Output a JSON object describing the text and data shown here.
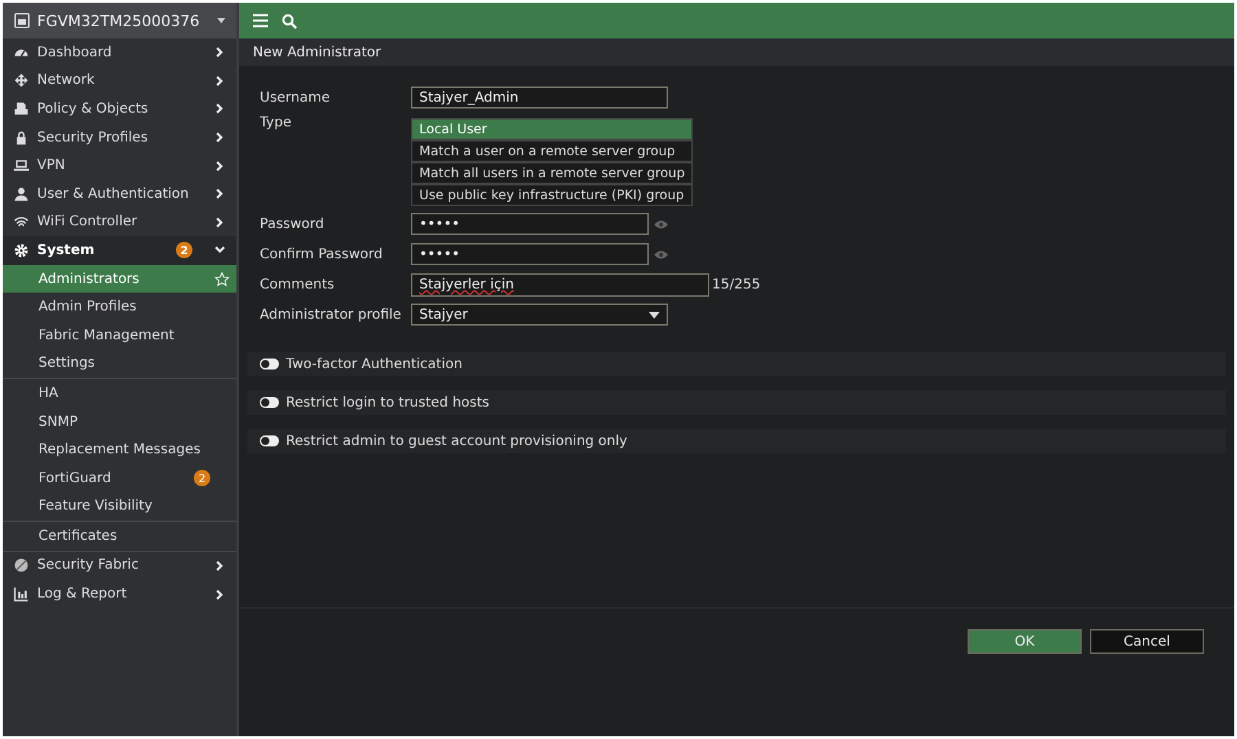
{
  "device": {
    "name": "FGVM32TM25000376"
  },
  "sidebar": {
    "items": [
      {
        "label": "Dashboard",
        "expanded": false
      },
      {
        "label": "Network",
        "expanded": false
      },
      {
        "label": "Policy & Objects",
        "expanded": false
      },
      {
        "label": "Security Profiles",
        "expanded": false
      },
      {
        "label": "VPN",
        "expanded": false
      },
      {
        "label": "User & Authentication",
        "expanded": false
      },
      {
        "label": "WiFi Controller",
        "expanded": false
      },
      {
        "label": "System",
        "expanded": true,
        "badge": "2",
        "groups": [
          [
            {
              "label": "Administrators",
              "selected": true
            },
            {
              "label": "Admin Profiles",
              "selected": false
            },
            {
              "label": "Fabric Management",
              "selected": false
            },
            {
              "label": "Settings",
              "selected": false
            }
          ],
          [
            {
              "label": "HA",
              "selected": false
            },
            {
              "label": "SNMP",
              "selected": false
            },
            {
              "label": "Replacement Messages",
              "selected": false
            },
            {
              "label": "FortiGuard",
              "selected": false,
              "badge": "2"
            },
            {
              "label": "Feature Visibility",
              "selected": false
            }
          ],
          [
            {
              "label": "Certificates",
              "selected": false
            }
          ]
        ]
      },
      {
        "label": "Security Fabric",
        "expanded": false
      },
      {
        "label": "Log & Report",
        "expanded": false
      }
    ]
  },
  "page": {
    "title": "New Administrator"
  },
  "form": {
    "username": {
      "label": "Username",
      "value": "Stajyer_Admin"
    },
    "type": {
      "label": "Type",
      "options": [
        {
          "label": "Local User",
          "selected": true
        },
        {
          "label": "Match a user on a remote server group",
          "selected": false
        },
        {
          "label": "Match all users in a remote server group",
          "selected": false
        },
        {
          "label": "Use public key infrastructure (PKI) group",
          "selected": false
        }
      ]
    },
    "password": {
      "label": "Password",
      "value": "•••••"
    },
    "confirm": {
      "label": "Confirm Password",
      "value": "•••••"
    },
    "comments": {
      "label": "Comments",
      "value": "Stajyerler için",
      "counter": "15/255"
    },
    "profile": {
      "label": "Administrator profile",
      "value": "Stajyer"
    }
  },
  "toggles": [
    {
      "label": "Two-factor Authentication",
      "on": false
    },
    {
      "label": "Restrict login to trusted hosts",
      "on": false
    },
    {
      "label": "Restrict admin to guest account provisioning only",
      "on": false
    }
  ],
  "buttons": {
    "ok": "OK",
    "cancel": "Cancel"
  }
}
